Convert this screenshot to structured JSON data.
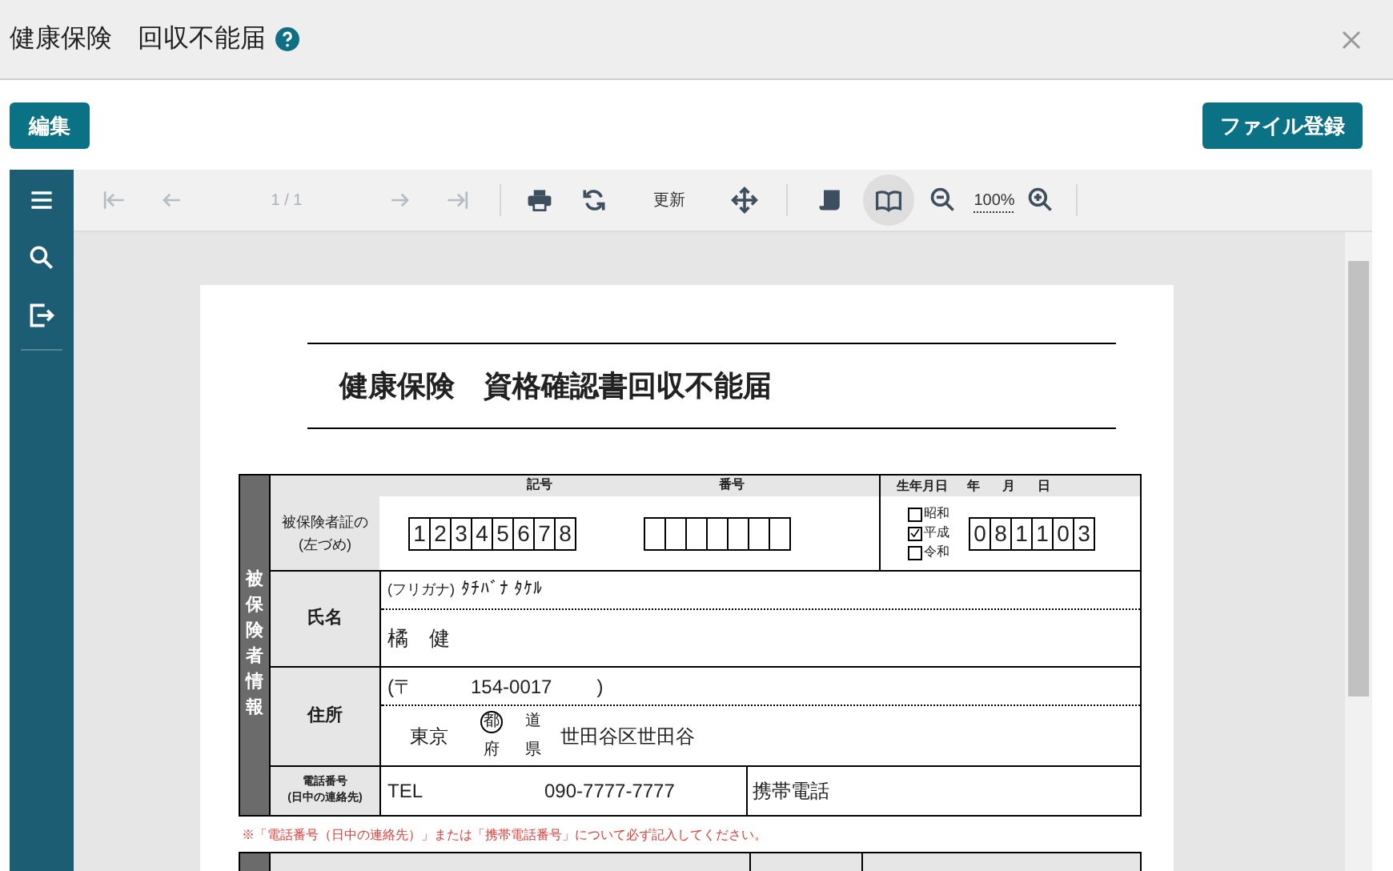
{
  "header": {
    "title": "健康保険　回収不能届"
  },
  "buttons": {
    "edit": "編集",
    "register": "ファイル登録"
  },
  "sidebar": [
    {
      "kind": "menu"
    },
    {
      "kind": "search"
    },
    {
      "kind": "export"
    }
  ],
  "toolbar": [
    {
      "kind": "first",
      "disabled": true
    },
    {
      "kind": "prev",
      "disabled": true
    },
    {
      "kind": "page",
      "text": "1 / 1",
      "disabled": true
    },
    {
      "kind": "next",
      "disabled": true
    },
    {
      "kind": "last",
      "disabled": true
    },
    {
      "kind": "sep"
    },
    {
      "kind": "print",
      "disabled": false
    },
    {
      "kind": "refresh",
      "disabled": false
    },
    {
      "kind": "label",
      "text": "更新",
      "disabled": false
    },
    {
      "kind": "move",
      "disabled": false
    },
    {
      "kind": "sep"
    },
    {
      "kind": "scroll",
      "disabled": false,
      "selected": false
    },
    {
      "kind": "book",
      "disabled": false,
      "selected": true
    },
    {
      "kind": "zoomout",
      "disabled": false
    },
    {
      "kind": "zoom",
      "text": "100%",
      "disabled": false
    },
    {
      "kind": "zoomin",
      "disabled": false
    },
    {
      "kind": "sep"
    }
  ],
  "document": {
    "title": "健康保険　資格確認書回収不能届",
    "section_label": "被保険者情報",
    "card": {
      "label": "被保険者証の\n(左づめ)",
      "symbol_heading": "記号",
      "number_heading": "番号",
      "symbol_digits": [
        "1",
        "2",
        "3",
        "4",
        "5",
        "6",
        "7",
        "8"
      ]
    },
    "birth": {
      "heading": "生年月日",
      "year": "年",
      "month": "月",
      "day": "日",
      "eras": [
        {
          "label": "昭和",
          "checked": false
        },
        {
          "label": "平成",
          "checked": true
        },
        {
          "label": "令和",
          "checked": false
        }
      ],
      "digits": [
        "0",
        "8",
        "1",
        "1",
        "0",
        "3"
      ]
    },
    "name": {
      "label": "氏名",
      "furigana_label": "(フリガナ)",
      "furigana": "ﾀﾁﾊﾞﾅ ﾀｹﾙ",
      "value": "橘　健"
    },
    "address": {
      "label": "住所",
      "postal_open": "(〒",
      "postal": "154-0017",
      "postal_close": ")",
      "prefecture": "東京",
      "suffixes": [
        {
          "label": "都",
          "selected": true
        },
        {
          "label": "道",
          "selected": false
        },
        {
          "label": "府",
          "selected": false
        },
        {
          "label": "県",
          "selected": false
        }
      ],
      "city": "世田谷区世田谷"
    },
    "phone": {
      "label": "電話番号\n(日中の連絡先)",
      "tel_label": "TEL",
      "tel": "090-7777-7777",
      "mobile_label": "携帯電話"
    },
    "note": "※「電話番号（日中の連絡先）」または「携帯電話番号」について必ず記入してください。"
  }
}
